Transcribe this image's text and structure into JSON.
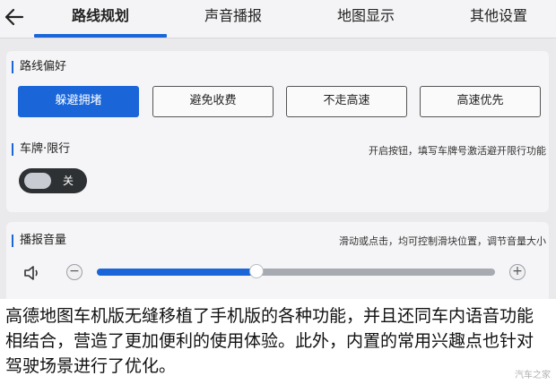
{
  "tabs": [
    {
      "label": "路线规划",
      "active": true
    },
    {
      "label": "声音播报",
      "active": false
    },
    {
      "label": "地图显示",
      "active": false
    },
    {
      "label": "其他设置",
      "active": false
    }
  ],
  "route_preference": {
    "title": "路线偏好",
    "options": [
      {
        "label": "躲避拥堵",
        "active": true
      },
      {
        "label": "避免收费",
        "active": false
      },
      {
        "label": "不走高速",
        "active": false
      },
      {
        "label": "高速优先",
        "active": false
      }
    ]
  },
  "plate_restriction": {
    "title": "车牌·限行",
    "hint": "开启按钮，填写车牌号激活避开限行功能",
    "toggle_label": "关",
    "toggle_on": false
  },
  "volume": {
    "title": "播报音量",
    "hint": "滑动或点击，均可控制滑块位置，调节音量大小",
    "minus": "−",
    "plus": "+",
    "level": 0.4
  },
  "caption": "高德地图车机版无缝移植了手机版的各种功能，并且还同车内语音功能相结合，营造了更加便利的使用体验。此外，内置的常用兴趣点也针对驾驶场景进行了优化。",
  "watermark": "汽车之家",
  "colors": {
    "accent": "#1a66d9"
  },
  "icons": {
    "back": "arrow-left-icon",
    "speaker": "speaker-icon"
  }
}
